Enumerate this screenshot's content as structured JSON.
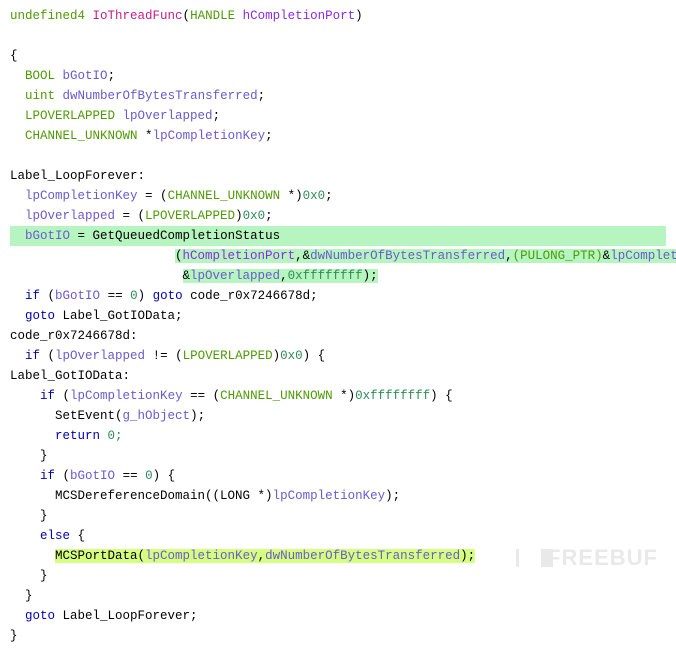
{
  "sig": {
    "ret": "undefined4",
    "name": "IoThreadFunc",
    "ptype": "HANDLE",
    "pname": "hCompletionPort"
  },
  "decl": {
    "t0": "BOOL",
    "v0": "bGotIO",
    "t1": "uint",
    "v1": "dwNumberOfBytesTransferred",
    "t2": "LPOVERLAPPED",
    "v2": "lpOverlapped",
    "t3": "CHANNEL_UNKNOWN",
    "v3": "lpCompletionKey"
  },
  "lbl": {
    "loop": "Label_LoopForever:",
    "code": "code_r0x7246678d:",
    "gotio": "Label_GotIOData:"
  },
  "s": {
    "assignKey": "lpCompletionKey = (CHANNEL_UNKNOWN *)",
    "zerohex": "0x0",
    "assignOv": "lpOverlapped = (LPOVERLAPPED)",
    "bGot": "bGotIO",
    "eq": " = ",
    "gqcs": "GetQueuedCompletionStatus",
    "callArgsA": "(hCompletionPort,&",
    "dwb": "dwNumberOfBytesTransferred",
    "comma": ",",
    "pulong": "(PULONG_PTR)",
    "amp": "&",
    "lpck": "lpCompletionKey",
    "lpov": "lpOverlapped",
    "ffff": "0xffffffff",
    "rparen": ");",
    "ifBgot0": "if (bGotIO == 0) ",
    "goto": "goto",
    "codeLbl": " code_r0x7246678d;",
    "gotoGot": " Label_GotIOData;",
    "ifOv": "if (lpOverlapped != (LPOVERLAPPED)",
    "ifKey": "if (lpCompletionKey == (CHANNEL_UNKNOWN *)",
    "SetEvent": "SetEvent",
    "gh": "g_hObject",
    "ret": "return",
    "ret0": " 0;",
    "ifBgot02": "if (bGotIO == 0) {",
    "mcsderef": "MCSDereferenceDomain",
    "longcast": "((LONG *)",
    "else": "else",
    "mcsport": "MCSPortData",
    "gotoLoop": " Label_LoopForever;"
  },
  "wm": "FREEBUF"
}
